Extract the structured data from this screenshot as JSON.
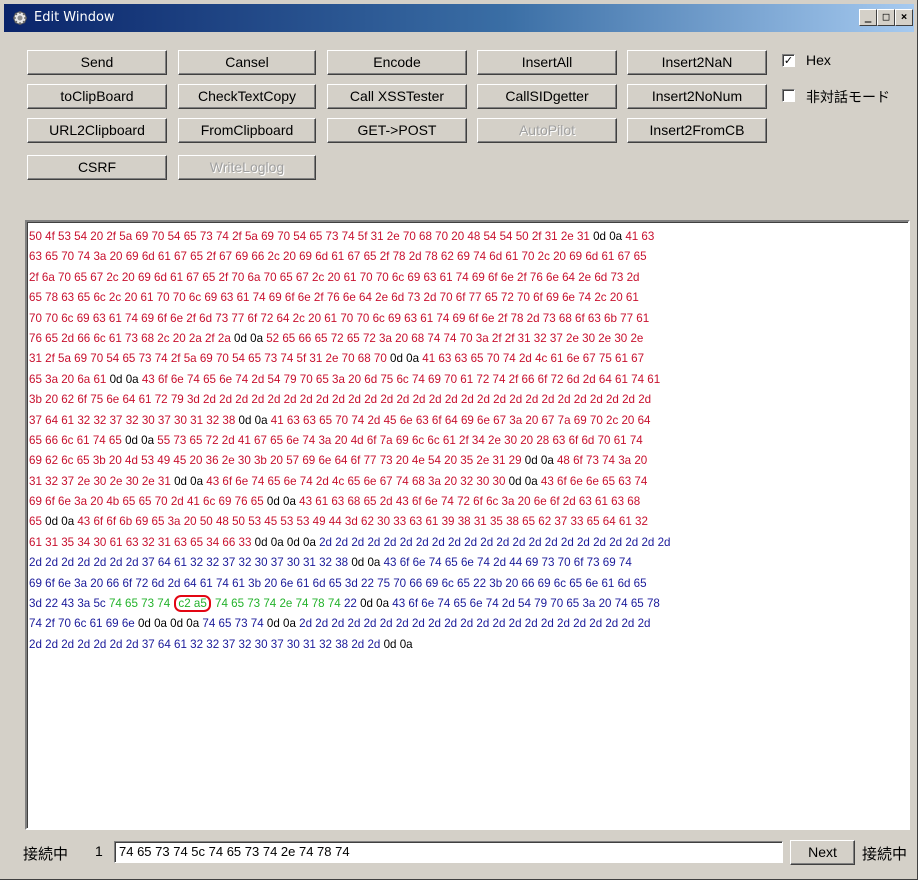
{
  "window": {
    "title": "Edit Window",
    "controls": [
      "_",
      "□",
      "×"
    ]
  },
  "toolbar": {
    "buttons": [
      {
        "label": "Send",
        "enabled": true
      },
      {
        "label": "Cansel",
        "enabled": true
      },
      {
        "label": "Encode",
        "enabled": true
      },
      {
        "label": "InsertAll",
        "enabled": true
      },
      {
        "label": "Insert2NaN",
        "enabled": true
      },
      {
        "label": "toClipBoard",
        "enabled": true
      },
      {
        "label": "CheckTextCopy",
        "enabled": true
      },
      {
        "label": "Call XSSTester",
        "enabled": true
      },
      {
        "label": "CallSIDgetter",
        "enabled": true
      },
      {
        "label": "Insert2NoNum",
        "enabled": true
      },
      {
        "label": "URL2Clipboard",
        "enabled": true
      },
      {
        "label": "FromClipboard",
        "enabled": true
      },
      {
        "label": "GET->POST",
        "enabled": true
      },
      {
        "label": "AutoPilot",
        "enabled": false
      },
      {
        "label": "Insert2FromCB",
        "enabled": true
      },
      {
        "label": "CSRF",
        "enabled": true
      },
      {
        "label": "WriteLoglog",
        "enabled": false
      }
    ],
    "hex_checkbox": {
      "label": "Hex",
      "checked": true
    },
    "noninteractive_checkbox": {
      "label": "非対話モード",
      "checked": false
    }
  },
  "hex_view": {
    "colors": {
      "red": "#c8102e",
      "blue": "#1a1a9a",
      "black": "#000000",
      "green": "#23b22b",
      "highlight": "#e30613"
    },
    "lines": [
      [
        {
          "c": "red",
          "t": "50 4f 53 54 20 2f 5a 69 70 54 65 73 74 2f 5a 69 70 54 65 73 74 5f 31 2e 70 68 70 20 48 54 54 50 2f 31 2e 31 "
        },
        {
          "c": "black",
          "t": "0d 0a"
        },
        {
          "c": "red",
          "t": " 41 63"
        }
      ],
      [
        {
          "c": "red",
          "t": "63 65 70 74 3a 20 69 6d 61 67 65 2f 67 69 66 2c 20 69 6d 61 67 65 2f 78 2d 78 62 69 74 6d 61 70 2c 20 69 6d 61 67 65"
        }
      ],
      [
        {
          "c": "red",
          "t": "2f 6a 70 65 67 2c 20 69 6d 61 67 65 2f 70 6a 70 65 67 2c 20 61 70 70 6c 69 63 61 74 69 6f 6e 2f 76 6e 64 2e 6d 73 2d"
        }
      ],
      [
        {
          "c": "red",
          "t": "65 78 63 65 6c 2c 20 61 70 70 6c 69 63 61 74 69 6f 6e 2f 76 6e 64 2e 6d 73 2d 70 6f 77 65 72 70 6f 69 6e 74 2c 20 61"
        }
      ],
      [
        {
          "c": "red",
          "t": "70 70 6c 69 63 61 74 69 6f 6e 2f 6d 73 77 6f 72 64 2c 20 61 70 70 6c 69 63 61 74 69 6f 6e 2f 78 2d 73 68 6f 63 6b 77 61"
        }
      ],
      [
        {
          "c": "red",
          "t": "76 65 2d 66 6c 61 73 68 2c 20 2a 2f 2a "
        },
        {
          "c": "black",
          "t": "0d 0a"
        },
        {
          "c": "red",
          "t": " 52 65 66 65 72 65 72 3a 20 68 74 74 70 3a 2f 2f 31 32 37 2e 30 2e 30 2e"
        }
      ],
      [
        {
          "c": "red",
          "t": "31 2f 5a 69 70 54 65 73 74 2f 5a 69 70 54 65 73 74 5f 31 2e 70 68 70 "
        },
        {
          "c": "black",
          "t": "0d 0a"
        },
        {
          "c": "red",
          "t": " 41 63 63 65 70 74 2d 4c 61 6e 67 75 61 67"
        }
      ],
      [
        {
          "c": "red",
          "t": "65 3a 20 6a 61 "
        },
        {
          "c": "black",
          "t": "0d 0a"
        },
        {
          "c": "red",
          "t": " 43 6f 6e 74 65 6e 74 2d 54 79 70 65 3a 20 6d 75 6c 74 69 70 61 72 74 2f 66 6f 72 6d 2d 64 61 74 61"
        }
      ],
      [
        {
          "c": "red",
          "t": "3b 20 62 6f 75 6e 64 61 72 79 3d 2d 2d 2d 2d 2d 2d 2d 2d 2d 2d 2d 2d 2d 2d 2d 2d 2d 2d 2d 2d 2d 2d 2d 2d 2d 2d 2d 2d"
        }
      ],
      [
        {
          "c": "red",
          "t": "37 64 61 32 32 37 32 30 37 30 31 32 38 "
        },
        {
          "c": "black",
          "t": "0d 0a"
        },
        {
          "c": "red",
          "t": " 41 63 63 65 70 74 2d 45 6e 63 6f 64 69 6e 67 3a 20 67 7a 69 70 2c 20 64"
        }
      ],
      [
        {
          "c": "red",
          "t": "65 66 6c 61 74 65 "
        },
        {
          "c": "black",
          "t": "0d 0a"
        },
        {
          "c": "red",
          "t": " 55 73 65 72 2d 41 67 65 6e 74 3a 20 4d 6f 7a 69 6c 6c 61 2f 34 2e 30 20 28 63 6f 6d 70 61 74"
        }
      ],
      [
        {
          "c": "red",
          "t": "69 62 6c 65 3b 20 4d 53 49 45 20 36 2e 30 3b 20 57 69 6e 64 6f 77 73 20 4e 54 20 35 2e 31 29 "
        },
        {
          "c": "black",
          "t": "0d 0a"
        },
        {
          "c": "red",
          "t": " 48 6f 73 74 3a 20"
        }
      ],
      [
        {
          "c": "red",
          "t": "31 32 37 2e 30 2e 30 2e 31 "
        },
        {
          "c": "black",
          "t": "0d 0a"
        },
        {
          "c": "red",
          "t": " 43 6f 6e 74 65 6e 74 2d 4c 65 6e 67 74 68 3a 20 32 30 30 "
        },
        {
          "c": "black",
          "t": "0d 0a"
        },
        {
          "c": "red",
          "t": " 43 6f 6e 6e 65 63 74"
        }
      ],
      [
        {
          "c": "red",
          "t": "69 6f 6e 3a 20 4b 65 65 70 2d 41 6c 69 76 65 "
        },
        {
          "c": "black",
          "t": "0d 0a"
        },
        {
          "c": "red",
          "t": " 43 61 63 68 65 2d 43 6f 6e 74 72 6f 6c 3a 20 6e 6f 2d 63 61 63 68"
        }
      ],
      [
        {
          "c": "red",
          "t": "65 "
        },
        {
          "c": "black",
          "t": "0d 0a"
        },
        {
          "c": "red",
          "t": " 43 6f 6f 6b 69 65 3a 20 50 48 50 53 45 53 53 49 44 3d 62 30 33 63 61 39 38 31 35 38 65 62 37 33 65 64 61 32"
        }
      ],
      [
        {
          "c": "red",
          "t": "61 31 35 34 30 61 63 32 31 63 65 34 66 33 "
        },
        {
          "c": "black",
          "t": "0d 0a 0d 0a"
        },
        {
          "c": "blue",
          "t": " 2d 2d 2d 2d 2d 2d 2d 2d 2d 2d 2d 2d 2d 2d 2d 2d 2d 2d 2d 2d 2d 2d"
        }
      ],
      [
        {
          "c": "blue",
          "t": "2d 2d 2d 2d 2d 2d 2d 37 64 61 32 32 37 32 30 37 30 31 32 38 "
        },
        {
          "c": "black",
          "t": "0d 0a"
        },
        {
          "c": "blue",
          "t": " 43 6f 6e 74 65 6e 74 2d 44 69 73 70 6f 73 69 74"
        }
      ],
      [
        {
          "c": "blue",
          "t": "69 6f 6e 3a 20 66 6f 72 6d 2d 64 61 74 61 3b 20 6e 61 6d 65 3d 22 75 70 66 69 6c 65 22 3b 20 66 69 6c 65 6e 61 6d 65"
        }
      ],
      [
        {
          "c": "blue",
          "t": "3d 22 43 3a 5c "
        },
        {
          "c": "green",
          "t": "74 65 73 74 "
        },
        {
          "c": "green",
          "t": "c2 a5",
          "mark": true
        },
        {
          "c": "green",
          "t": " 74 65 73 74 2e 74 78 74"
        },
        {
          "c": "blue",
          "t": " 22 "
        },
        {
          "c": "black",
          "t": "0d 0a"
        },
        {
          "c": "blue",
          "t": " 43 6f 6e 74 65 6e 74 2d 54 79 70 65 3a 20 74 65 78"
        }
      ],
      [
        {
          "c": "blue",
          "t": "74 2f 70 6c 61 69 6e "
        },
        {
          "c": "black",
          "t": "0d 0a 0d 0a"
        },
        {
          "c": "blue",
          "t": " 74 65 73 74 "
        },
        {
          "c": "black",
          "t": "0d 0a"
        },
        {
          "c": "blue",
          "t": " 2d 2d 2d 2d 2d 2d 2d 2d 2d 2d 2d 2d 2d 2d 2d 2d 2d 2d 2d 2d 2d 2d"
        }
      ],
      [
        {
          "c": "blue",
          "t": "2d 2d 2d 2d 2d 2d 2d 37 64 61 32 32 37 32 30 37 30 31 32 38 2d 2d "
        },
        {
          "c": "black",
          "t": "0d 0a"
        }
      ]
    ]
  },
  "statusbar": {
    "left_label": "接続中",
    "number": "1",
    "input_value": "74 65 73 74 5c 74 65 73 74 2e 74 78 74",
    "next_label": "Next",
    "right_label": "接続中"
  }
}
